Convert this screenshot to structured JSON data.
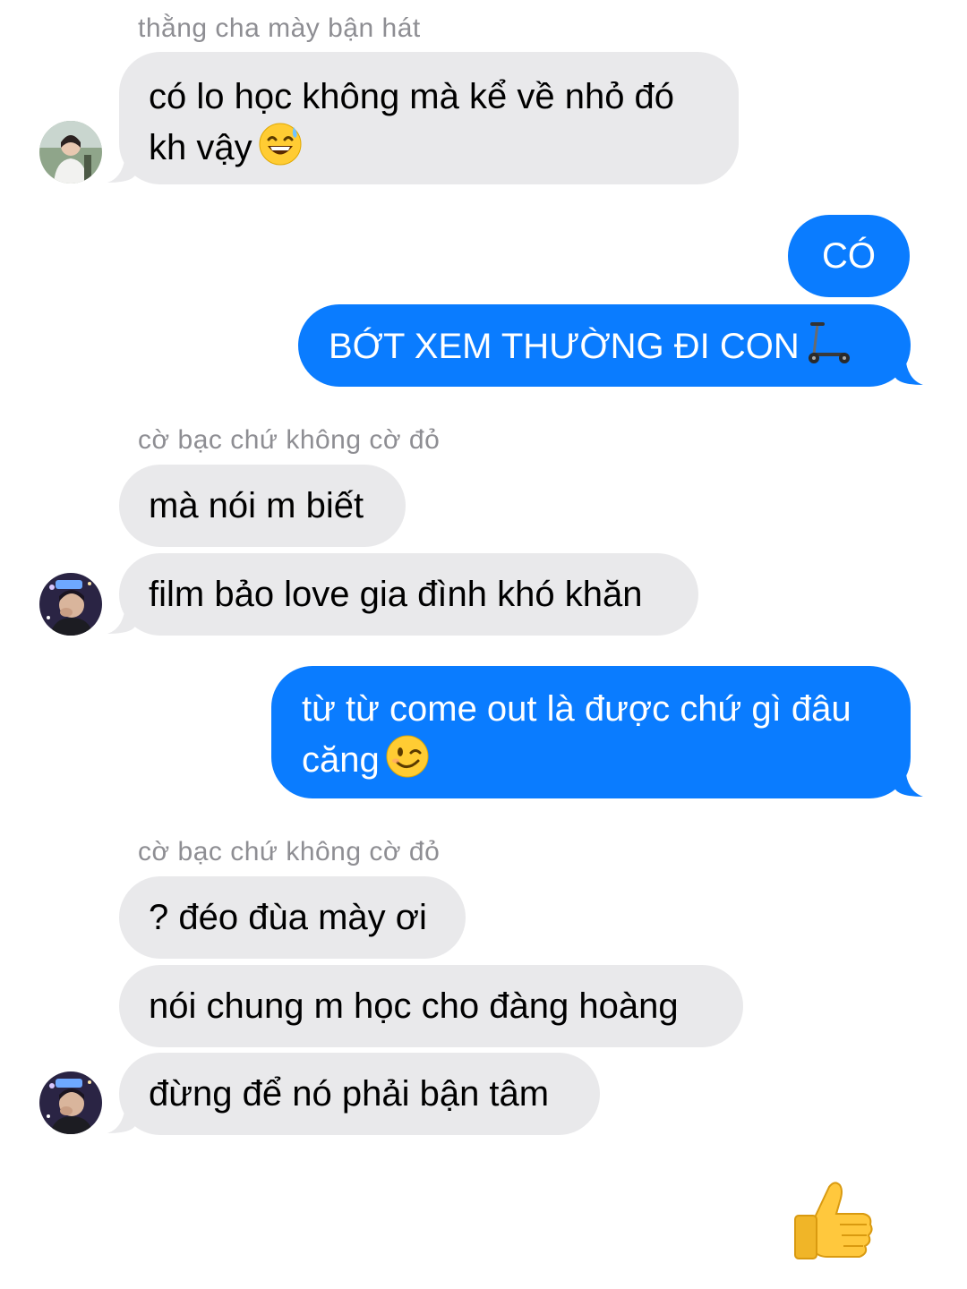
{
  "conversation": {
    "group1": {
      "sender": "thằng cha mày bận hát",
      "messages": [
        {
          "line1": "có lo học không mà kể về nhỏ đó",
          "line2": "kh vậy",
          "emoji": "grinning-sweat-emoji"
        }
      ]
    },
    "outgoing1": {
      "messages": [
        {
          "text": "CÓ"
        },
        {
          "text": "BỚT XEM THƯỜNG ĐI CON",
          "emoji": "kick-scooter-emoji"
        }
      ]
    },
    "group2": {
      "sender": "cờ bạc chứ không cờ đỏ",
      "messages": [
        {
          "text": "mà nói m biết"
        },
        {
          "text": "film bảo love gia đình khó khăn"
        }
      ]
    },
    "outgoing2": {
      "messages": [
        {
          "line1": "từ từ come out là được chứ gì đâu",
          "line2": "căng",
          "emoji": "winking-face-emoji"
        }
      ]
    },
    "group3": {
      "sender": "cờ bạc chứ không cờ đỏ",
      "messages": [
        {
          "text": "? đéo đùa mày ơi"
        },
        {
          "text": "nói chung m học cho đàng hoàng"
        },
        {
          "text": "đừng để nó phải bận tâm"
        }
      ]
    },
    "reaction": {
      "emoji": "thumbs-up-emoji"
    }
  },
  "colors": {
    "incoming_bubble": "#e9e9eb",
    "outgoing_bubble": "#0a7cff",
    "sender_name": "#8e8e93",
    "background": "#ffffff"
  }
}
